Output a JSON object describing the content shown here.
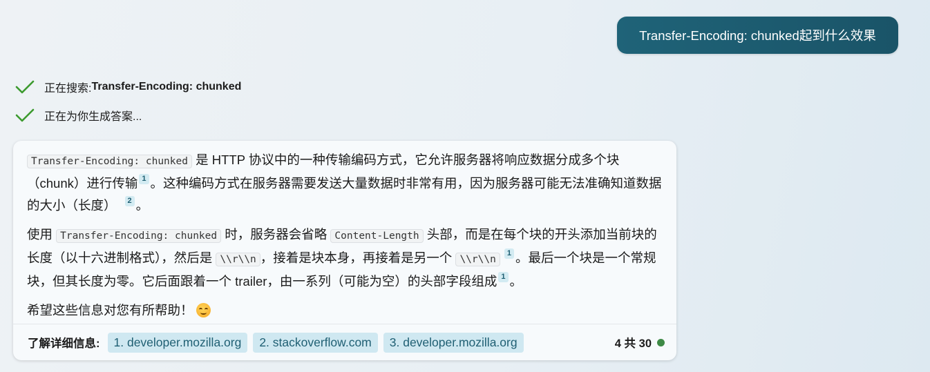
{
  "user_message": "Transfer-Encoding: chunked起到什么效果",
  "status": {
    "searching_label": "正在搜索: ",
    "searching_query": "Transfer-Encoding: chunked",
    "generating_label": "正在为你生成答案..."
  },
  "answer": {
    "p1": {
      "code1": "Transfer-Encoding: chunked",
      "t1": " 是 HTTP 协议中的一种传输编码方式，它允许服务器将响应数据分成多个块（chunk）进行传输",
      "c1": "1",
      "t2": "。这种编码方式在服务器需要发送大量数据时非常有用，因为服务器可能无法准确知道数据的大小（长度）",
      "c2": "2",
      "t3": "。"
    },
    "p2": {
      "t1": "使用 ",
      "code1": "Transfer-Encoding: chunked",
      "t2": " 时，服务器会省略 ",
      "code2": "Content-Length",
      "t3": " 头部，而是在每个块的开头添加当前块的长度（以十六进制格式），然后是 ",
      "code3": "\\\\r\\\\n",
      "t4": "，接着是块本身，再接着是另一个 ",
      "code4": "\\\\r\\\\n",
      "c1": "1",
      "t5": "。最后一个块是一个常规块，但其长度为零。它后面跟着一个 trailer，由一系列（可能为空）的头部字段组成",
      "c2": "1",
      "t6": "。"
    },
    "p3": {
      "text": "希望这些信息对您有所帮助！",
      "emoji": "smiling-face-icon"
    }
  },
  "footer": {
    "label": "了解详细信息:",
    "sources": [
      "1. developer.mozilla.org",
      "2. stackoverflow.com",
      "3. developer.mozilla.org"
    ],
    "counter": "4 共 30",
    "status_color": "#3e8a46"
  },
  "colors": {
    "accent": "#1f6378",
    "check": "#3c9a2e",
    "link_bg": "#cfe8f1",
    "link_text": "#1f5f73"
  }
}
